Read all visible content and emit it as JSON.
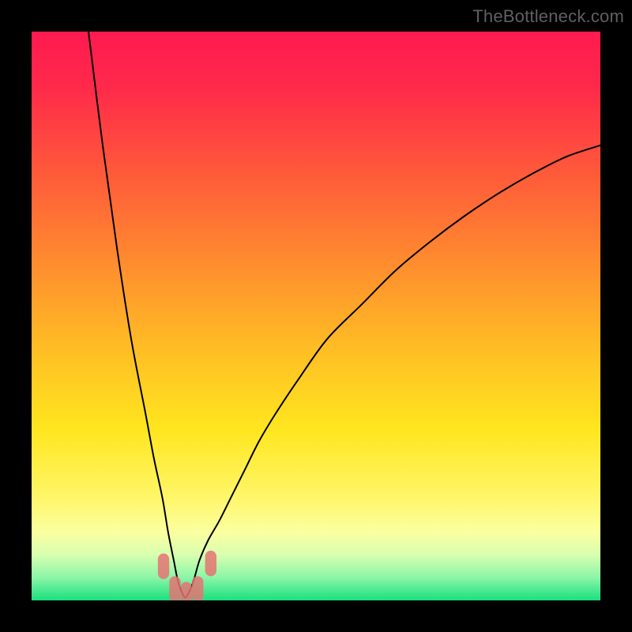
{
  "watermark": "TheBottleneck.com",
  "chart_data": {
    "type": "line",
    "title": "",
    "xlabel": "",
    "ylabel": "",
    "xlim": [
      0,
      100
    ],
    "ylim": [
      0,
      100
    ],
    "background": {
      "type": "vertical-gradient",
      "stops": [
        {
          "pos": 0.0,
          "color": "#ff1a50"
        },
        {
          "pos": 0.1,
          "color": "#ff2a4a"
        },
        {
          "pos": 0.25,
          "color": "#ff5a3a"
        },
        {
          "pos": 0.4,
          "color": "#ff8a2f"
        },
        {
          "pos": 0.55,
          "color": "#ffbb25"
        },
        {
          "pos": 0.7,
          "color": "#ffe61f"
        },
        {
          "pos": 0.82,
          "color": "#fff66a"
        },
        {
          "pos": 0.88,
          "color": "#fbffa0"
        },
        {
          "pos": 0.92,
          "color": "#d8ffb0"
        },
        {
          "pos": 0.96,
          "color": "#8bf5a8"
        },
        {
          "pos": 1.0,
          "color": "#19e07e"
        }
      ]
    },
    "series": [
      {
        "name": "curve",
        "color": "#000000",
        "stroke_width": 2,
        "x": [
          10.0,
          12.5,
          15.0,
          17.5,
          20.0,
          21.5,
          23.0,
          24.0,
          25.0,
          25.7,
          26.4,
          27.0,
          27.7,
          28.5,
          29.5,
          31.0,
          33.0,
          35.0,
          37.5,
          40.0,
          43.0,
          47.0,
          52.0,
          58.0,
          64.0,
          70.0,
          76.0,
          82.0,
          88.0,
          94.0,
          100.0
        ],
        "y": [
          100.0,
          80.0,
          62.0,
          46.0,
          33.0,
          25.0,
          18.0,
          12.0,
          7.0,
          3.5,
          1.5,
          0.5,
          1.5,
          3.5,
          7.0,
          10.5,
          14.0,
          18.0,
          23.0,
          28.0,
          33.0,
          39.0,
          46.0,
          52.0,
          58.0,
          63.0,
          67.5,
          71.5,
          75.0,
          78.0,
          80.0
        ]
      }
    ],
    "markers": {
      "name": "bottom-highlight",
      "color": "#e57373",
      "opacity": 0.85,
      "shape": "rounded-rect",
      "width": 2.0,
      "height": 4.5,
      "points": [
        {
          "x": 23.2,
          "y": 6.0
        },
        {
          "x": 25.2,
          "y": 2.0
        },
        {
          "x": 27.2,
          "y": 1.0
        },
        {
          "x": 29.2,
          "y": 2.0
        },
        {
          "x": 31.5,
          "y": 6.5
        }
      ]
    }
  }
}
